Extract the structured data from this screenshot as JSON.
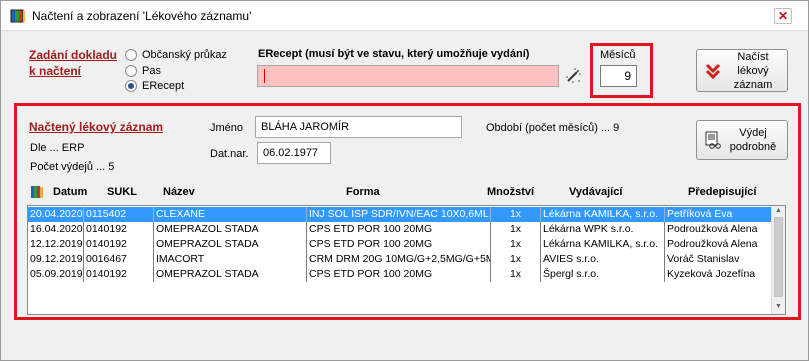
{
  "window": {
    "title": "Načtení a zobrazení 'Lékového záznamu'",
    "close_glyph": "✕"
  },
  "zadani": {
    "heading_line1": "Zadání dokladu",
    "heading_line2": "k načtení",
    "options": [
      {
        "label": "Občanský průkaz",
        "checked": false
      },
      {
        "label": "Pas",
        "checked": false
      },
      {
        "label": "ERecept",
        "checked": true
      }
    ],
    "erecept_label": "ERecept (musí být ve stavu, který umožňuje vydání)",
    "erecept_value": ""
  },
  "mesicu": {
    "label": "Měsíců",
    "value": "9"
  },
  "buttons": {
    "nacist_line1": "Načíst lékový",
    "nacist_line2": "záznam",
    "vydej_line1": "Výdej",
    "vydej_line2": "podrobně"
  },
  "zaznam": {
    "heading": "Načtený lékový záznam",
    "dle": "Dle ... ERP",
    "pocet_vydeju": "Počet výdejů ... 5",
    "jmeno_label": "Jméno",
    "jmeno_value": "BLÁHA JAROMÍR",
    "datnar_label": "Dat.nar.",
    "datnar_value": "06.02.1977",
    "obdobi": "Období (počet měsíců) ... 9"
  },
  "table": {
    "columns": [
      "Datum",
      "SUKL",
      "Název",
      "Forma",
      "Množství",
      "Vydávající",
      "Předepisující"
    ],
    "rows": [
      [
        "20.04.2020",
        "0115402",
        "CLEXANE",
        "INJ SOL ISP SDR/IVN/EAC 10X0,6ML I",
        "1x",
        "Lékárna KAMILKA, s.r.o.",
        "Petříková Eva"
      ],
      [
        "16.04.2020",
        "0140192",
        "OMEPRAZOL STADA",
        "CPS ETD POR 100 20MG",
        "1x",
        "Lékárna WPK s.r.o.",
        "Podroužková Alena"
      ],
      [
        "12.12.2019",
        "0140192",
        "OMEPRAZOL STADA",
        "CPS ETD POR 100 20MG",
        "1x",
        "Lékárna KAMILKA, s.r.o.",
        "Podroužková Alena"
      ],
      [
        "09.12.2019",
        "0016467",
        "IMACORT",
        "CRM DRM 20G 10MG/G+2,5MG/G+5M",
        "1x",
        "AVIES s.r.o.",
        "Voráč Stanislav"
      ],
      [
        "05.09.2019",
        "0140192",
        "OMEPRAZOL STADA",
        "CPS ETD POR 100 20MG",
        "1x",
        "Špergl s.r.o.",
        "Kyzeková Jozefína"
      ]
    ],
    "selected_row": 0
  },
  "colors": {
    "accent_red": "#e0151f",
    "link_red": "#a01c1c",
    "selection_blue": "#3399ff",
    "erecept_bg": "#ffc0c0"
  }
}
